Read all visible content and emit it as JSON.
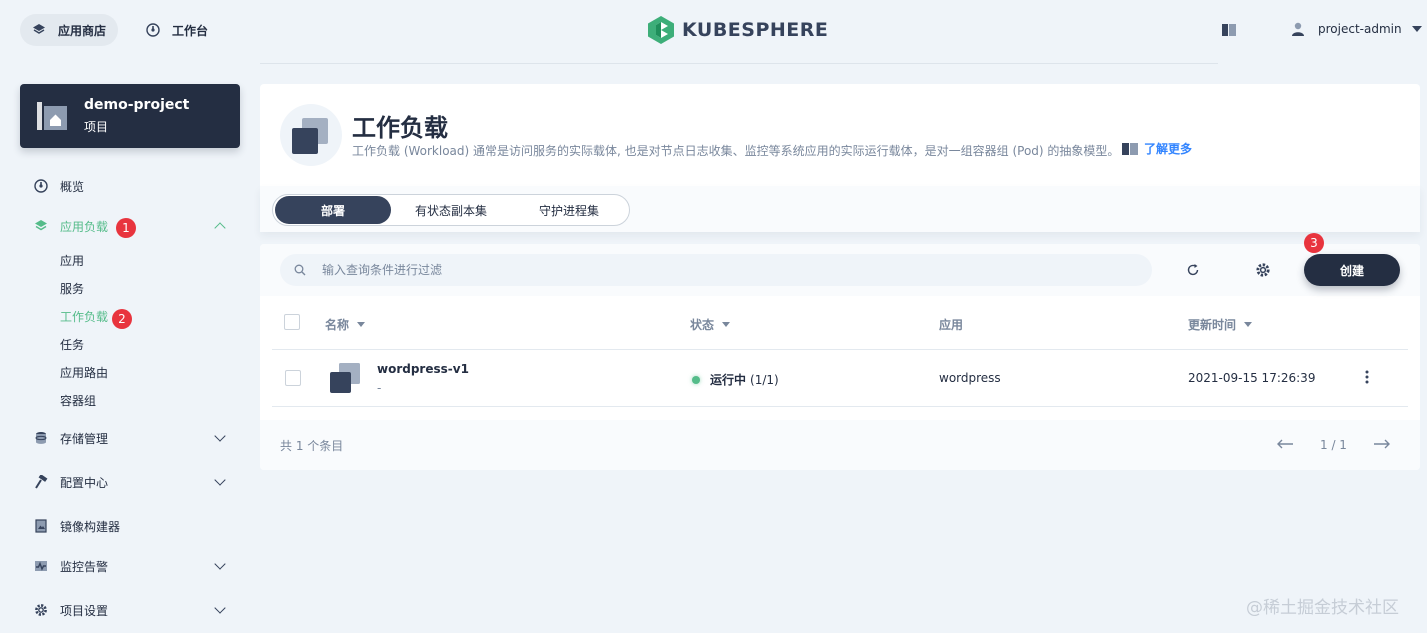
{
  "topbar": {
    "app_store_label": "应用商店",
    "workbench_label": "工作台",
    "logo_text": "KUBESPHERE",
    "username": "project-admin"
  },
  "project": {
    "name": "demo-project",
    "type_label": "项目"
  },
  "sidebar": {
    "items": [
      {
        "label": "概览",
        "icon": "dashboard-icon"
      },
      {
        "label": "应用负载",
        "icon": "layers-icon",
        "badge": "1",
        "expanded": true
      },
      {
        "label": "存储管理",
        "icon": "storage-icon"
      },
      {
        "label": "配置中心",
        "icon": "hammer-icon"
      },
      {
        "label": "镜像构建器",
        "icon": "image-builder-icon"
      },
      {
        "label": "监控告警",
        "icon": "monitor-icon"
      },
      {
        "label": "项目设置",
        "icon": "gear-icon"
      }
    ],
    "sub_items": [
      {
        "label": "应用"
      },
      {
        "label": "服务"
      },
      {
        "label": "工作负载",
        "badge": "2",
        "active": true
      },
      {
        "label": "任务"
      },
      {
        "label": "应用路由"
      },
      {
        "label": "容器组"
      }
    ]
  },
  "banner": {
    "title": "工作负载",
    "description": "工作负载 (Workload) 通常是访问服务的实际载体, 也是对节点日志收集、监控等系统应用的实际运行载体，是对一组容器组 (Pod) 的抽象模型。",
    "learn_more": "了解更多"
  },
  "tabs": [
    {
      "label": "部署",
      "active": true
    },
    {
      "label": "有状态副本集"
    },
    {
      "label": "守护进程集"
    }
  ],
  "toolbar": {
    "search_placeholder": "输入查询条件进行过滤",
    "create_label": "创建",
    "create_badge": "3"
  },
  "table": {
    "columns": [
      "名称",
      "状态",
      "应用",
      "更新时间"
    ],
    "rows": [
      {
        "name": "wordpress-v1",
        "description": "-",
        "status": "运行中",
        "status_count": "(1/1)",
        "app": "wordpress",
        "updated": "2021-09-15 17:26:39"
      }
    ]
  },
  "footer": {
    "total": "共 1 个条目",
    "page": "1 / 1"
  },
  "watermark": "@稀土掘金技术社区",
  "colors": {
    "accent_green": "#55bc8a",
    "dark": "#242e42",
    "badge_red": "#e8343e",
    "link_blue": "#3385ff"
  }
}
